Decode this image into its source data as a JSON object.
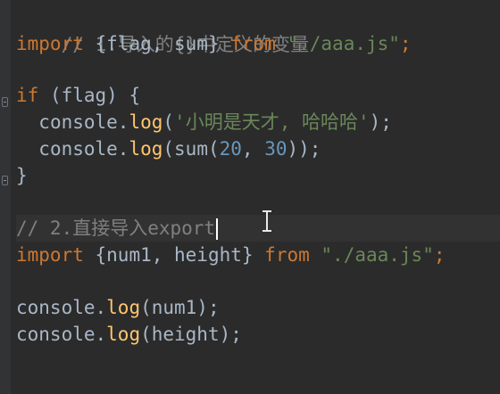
{
  "editor": {
    "lines": [
      {
        "comment": "// 1.导入的{}中定义的变量"
      },
      {
        "kw": "import",
        "open": " {",
        "vars": "flag, sum",
        "close": "} ",
        "kw2": "from",
        "sp": " ",
        "path": "\"./aaa.js\"",
        "end": ";"
      },
      {},
      {
        "kw": "if",
        "rest": " (flag) {"
      },
      {
        "indent": "  ",
        "obj": "console.",
        "fn": "log",
        "open": "(",
        "str": "'小明是天才, 哈哈哈'",
        "close": ");"
      },
      {
        "indent": "  ",
        "obj": "console.",
        "fn": "log",
        "open": "(sum(",
        "n1": "20",
        "comma": ", ",
        "n2": "30",
        "close": "));"
      },
      {
        "brace": "}"
      },
      {},
      {
        "comment": "// 2.直接导入export"
      },
      {
        "kw": "import",
        "open": " {",
        "vars": "num1, height",
        "close": "} ",
        "kw2": "from",
        "sp": " ",
        "path": "\"./aaa.js\"",
        "end": ";"
      },
      {},
      {
        "obj": "console.",
        "fn": "log",
        "args": "(num1);"
      },
      {
        "obj": "console.",
        "fn": "log",
        "args": "(height);"
      }
    ]
  },
  "colors": {
    "background": "#2b2b2b",
    "keyword": "#cc7832",
    "comment": "#808080",
    "string": "#6a8759",
    "number": "#6897bb",
    "function": "#ffc66d",
    "text": "#a9b7c6"
  },
  "icons": {
    "fold_marker": "fold-marker-icon",
    "mouse_cursor": "text-cursor-icon"
  }
}
